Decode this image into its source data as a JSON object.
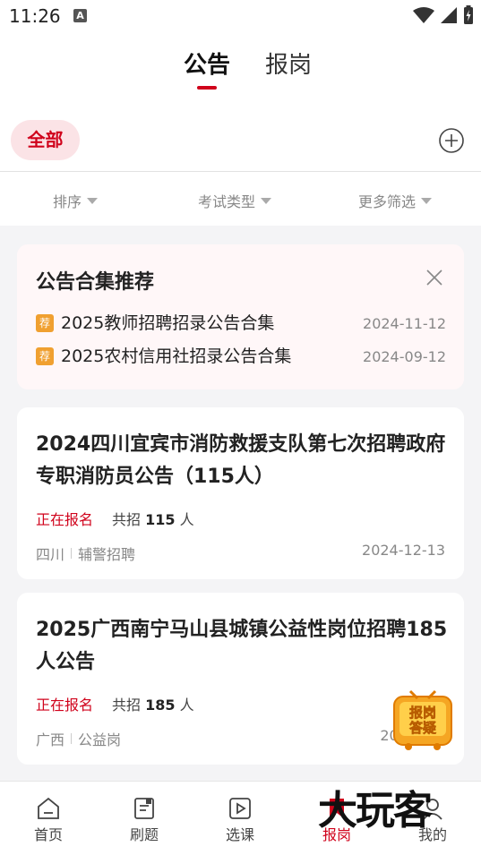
{
  "status_bar": {
    "time": "11:26",
    "notif_icon_letter": "A"
  },
  "top_tabs": [
    {
      "label": "公告",
      "active": true
    },
    {
      "label": "报岗",
      "active": false
    }
  ],
  "category": {
    "all_label": "全部"
  },
  "filters": [
    {
      "label": "排序"
    },
    {
      "label": "考试类型"
    },
    {
      "label": "更多筛选"
    }
  ],
  "recommend": {
    "title": "公告合集推荐",
    "items": [
      {
        "badge": "荐",
        "text": "2025教师招聘招录公告合集",
        "date": "2024-11-12"
      },
      {
        "badge": "荐",
        "text": "2025农村信用社招录公告合集",
        "date": "2024-09-12"
      }
    ]
  },
  "jobs": [
    {
      "title": "2024四川宜宾市消防救援支队第七次招聘政府专职消防员公告（115人）",
      "status": "正在报名",
      "total_prefix": "共招",
      "total_count": "115",
      "total_suffix": "人",
      "region": "四川",
      "category": "辅警招聘",
      "date": "2024-12-13"
    },
    {
      "title": "2025广西南宁马山县城镇公益性岗位招聘185人公告",
      "status": "正在报名",
      "total_prefix": "共招",
      "total_count": "185",
      "total_suffix": "人",
      "region": "广西",
      "category": "公益岗",
      "date": "2024-12-"
    }
  ],
  "float_badge": {
    "line1": "报岗",
    "line2": "答疑"
  },
  "bottom_nav": [
    {
      "label": "首页",
      "icon": "home-icon",
      "active": false
    },
    {
      "label": "刷题",
      "icon": "exercise-icon",
      "active": false
    },
    {
      "label": "选课",
      "icon": "video-course-icon",
      "active": false
    },
    {
      "label": "报岗",
      "icon": "job-report-icon",
      "active": true
    },
    {
      "label": "我的",
      "icon": "profile-icon",
      "active": false
    }
  ],
  "watermark": {
    "text": "大玩客"
  },
  "colors": {
    "accent": "#d0021b",
    "badge": "#f0a030",
    "background": "#f4f4f6"
  }
}
